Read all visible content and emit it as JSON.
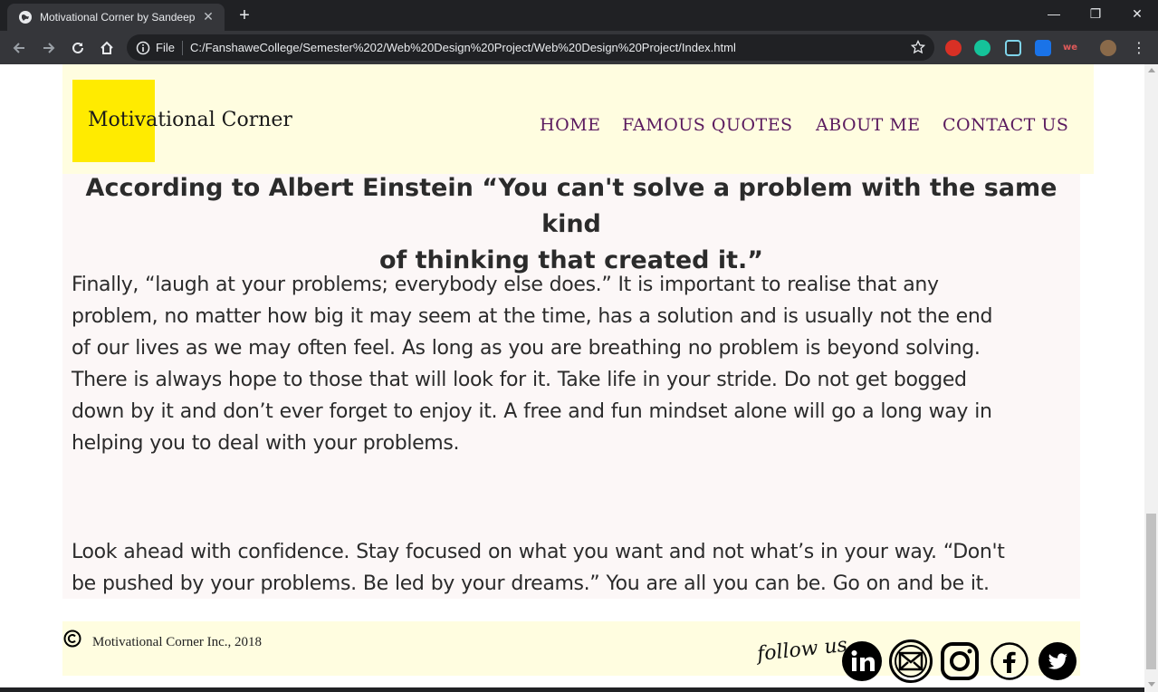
{
  "browser": {
    "tab_title": "Motivational Corner by Sandeep",
    "tab_close": "✕",
    "new_tab": "+",
    "window_controls": {
      "minimize": "—",
      "restore": "❐",
      "close": "✕"
    },
    "omnibox": {
      "scheme_label": "File",
      "url": "C:/FanshaweCollege/Semester%202/Web%20Design%20Project/Web%20Design%20Project/Index.html"
    }
  },
  "site": {
    "logo": "Motivational Corner",
    "nav": [
      "HOME",
      "FAMOUS QUOTES",
      "ABOUT ME",
      "CONTACT US"
    ]
  },
  "article": {
    "quote_line1": "According to Albert Einstein “You can't solve a problem with the same kind",
    "quote_line2": "of thinking that created it.”",
    "paragraph1": [
      "Finally, “laugh at your problems; everybody else does.” It is important to realise that any",
      "problem, no matter how big it may seem at the time, has a solution and is usually not the end",
      "of our lives as we may often feel. As long as you are breathing no problem is beyond solving.",
      "There is always hope to those that will look for it. Take life in your stride. Do not get bogged",
      "down by it and don’t ever forget to enjoy it. A free and fun mindset alone will go a long way in",
      "helping you to deal with your problems."
    ],
    "paragraph2": [
      "Look ahead with confidence. Stay focused on what you want and not what’s in your way. “Don't",
      "be pushed by your problems. Be led by your dreams.” You are all you can be. Go on and be it."
    ]
  },
  "footer": {
    "copyright": "Motivational Corner Inc., 2018",
    "follow_us": "follow us",
    "social_icons": [
      "linkedin-icon",
      "email-icon",
      "instagram-icon",
      "facebook-icon",
      "twitter-icon"
    ]
  },
  "colors": {
    "header_bg": "#fffde0",
    "logo_accent": "#ffeb00",
    "nav_text": "#5a1a5e",
    "content_bg": "#fcf7f7"
  }
}
